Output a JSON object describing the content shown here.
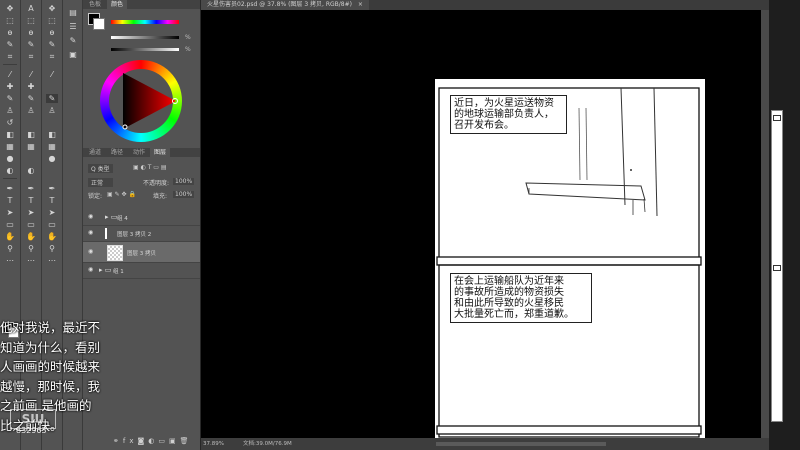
{
  "document": {
    "tab_title": "火星伤害员02.psd @ 37.8% (图层 3 拷贝, RGB/8#)",
    "zoom": "37.89%",
    "doc_info": "文档:39.0M/76.9M"
  },
  "color_panel": {
    "tabs": [
      "色板",
      "颜色"
    ],
    "slider_unit": "%"
  },
  "layers_panel": {
    "tabs": [
      "通道",
      "路径",
      "动作",
      "图层"
    ],
    "filter_label": "Q 类型",
    "blend_mode": "正常",
    "opacity_label": "不透明度:",
    "opacity_value": "100%",
    "lock_label": "锁定:",
    "fill_label": "填充:",
    "fill_value": "100%",
    "layers": [
      {
        "name": "组 4"
      },
      {
        "name": "图层 3 拷贝 2"
      },
      {
        "name": "图层 3 拷贝"
      },
      {
        "name": "组 1"
      }
    ]
  },
  "comic": {
    "caption1": [
      "近日，为火星运送物资",
      "的地球运输部负责人，",
      "召开发布会。"
    ],
    "caption2": [
      "在会上运输船队为近年来",
      "的事故所造成的物资损失",
      "和由此所导致的火星移民",
      "大批量死亡而，郑重道歉。"
    ]
  },
  "subtitle_lines": [
    "他对我说，最近不",
    "知道为什么，看别",
    "人画画的时候越来",
    "越慢，那时候，我",
    "之前画    是他画的",
    "比之前快。"
  ],
  "watermark": {
    "logo": "SIU",
    "id": "832963"
  },
  "colors": {
    "accent_red": "#ff0000",
    "canvas_bg": "#000000",
    "panel_bg": "#535353"
  }
}
